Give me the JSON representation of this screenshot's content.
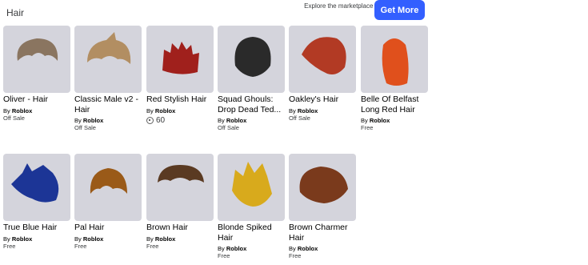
{
  "section": {
    "title": "Hair"
  },
  "promo": {
    "text": "Explore the marketplace to find more Hair!",
    "button_label": "Get More"
  },
  "items": [
    {
      "name": "Oliver - Hair",
      "creator_prefix": "By",
      "creator": "Roblox",
      "price": "Off Sale",
      "icon": "hair-oliver-icon",
      "color": "#8a7560"
    },
    {
      "name": "Classic Male v2 - Hair",
      "creator_prefix": "By",
      "creator": "Roblox",
      "price": "Off Sale",
      "icon": "hair-classic-male-icon",
      "color": "#b28e62"
    },
    {
      "name": "Red Stylish Hair",
      "creator_prefix": "By",
      "creator": "Roblox",
      "price": "60",
      "robux": true,
      "icon": "hair-red-stylish-icon",
      "color": "#a0201c"
    },
    {
      "name": "Squad Ghouls: Drop Dead Ted...",
      "creator_prefix": "By",
      "creator": "Roblox",
      "price": "Off Sale",
      "icon": "hair-squad-ghouls-icon",
      "color": "#2a2a2a"
    },
    {
      "name": "Oakley's Hair",
      "creator_prefix": "By",
      "creator": "Roblox",
      "price": "Off Sale",
      "icon": "hair-oakley-icon",
      "color": "#b23a24"
    },
    {
      "name": "Belle Of Belfast Long Red Hair",
      "creator_prefix": "By",
      "creator": "Roblox",
      "price": "Free",
      "icon": "hair-belle-icon",
      "color": "#e0501c"
    },
    {
      "name": "True Blue Hair",
      "creator_prefix": "By",
      "creator": "Roblox",
      "price": "Free",
      "icon": "hair-true-blue-icon",
      "color": "#1c3596"
    },
    {
      "name": "Pal Hair",
      "creator_prefix": "By",
      "creator": "Roblox",
      "price": "Free",
      "icon": "hair-pal-icon",
      "color": "#9a5a18"
    },
    {
      "name": "Brown Hair",
      "creator_prefix": "By",
      "creator": "Roblox",
      "price": "Free",
      "icon": "hair-brown-icon",
      "color": "#5a3a22"
    },
    {
      "name": "Blonde Spiked Hair",
      "creator_prefix": "By",
      "creator": "Roblox",
      "price": "Free",
      "icon": "hair-blonde-spiked-icon",
      "color": "#d8aa1c"
    },
    {
      "name": "Brown Charmer Hair",
      "creator_prefix": "By",
      "creator": "Roblox",
      "price": "Free",
      "icon": "hair-brown-charmer-icon",
      "color": "#7a3a1c"
    }
  ]
}
